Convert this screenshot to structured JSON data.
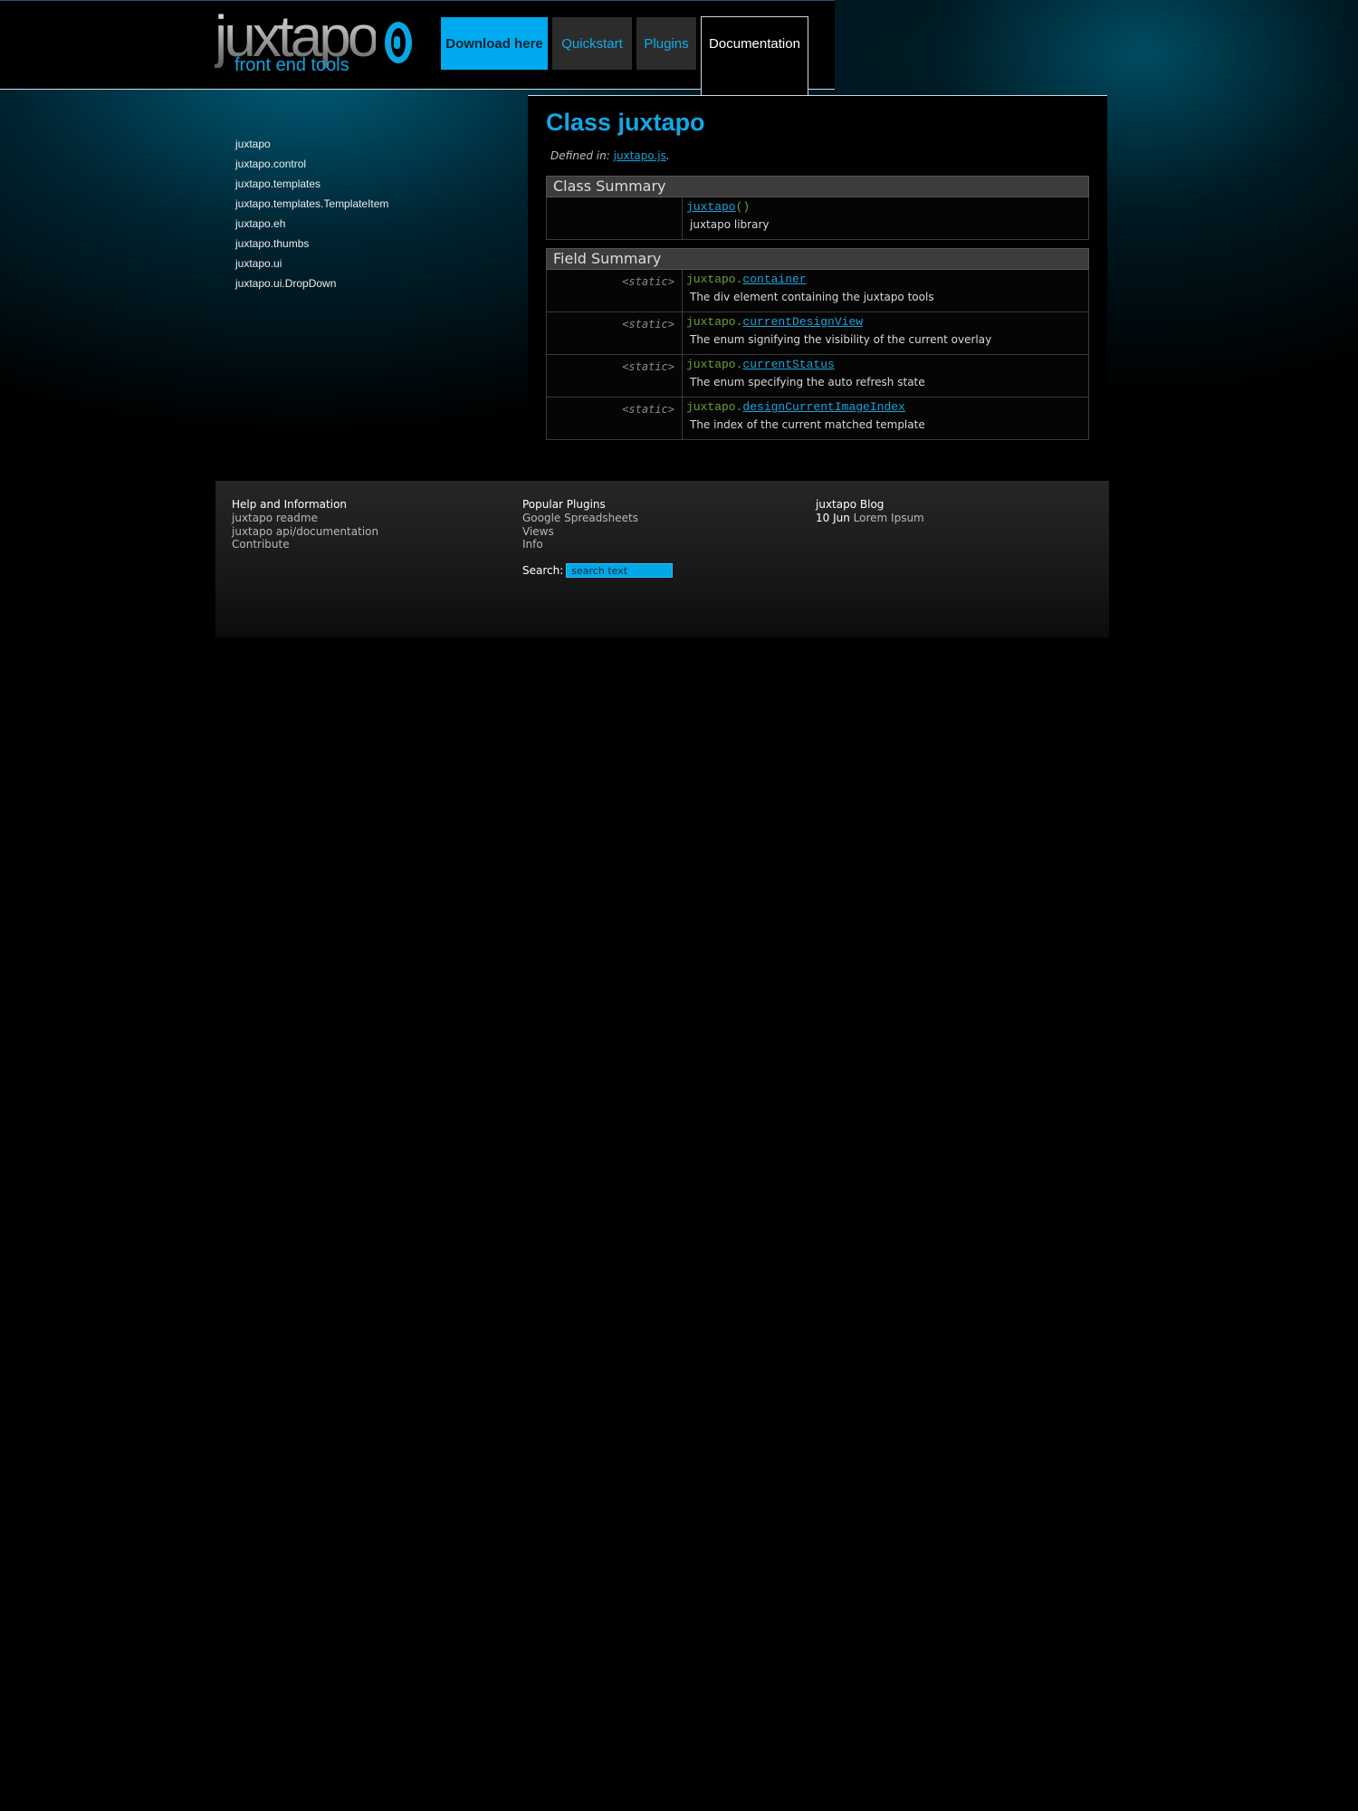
{
  "header": {
    "logo_word": "juxtapo",
    "logo_tagline": "front end tools",
    "nav": {
      "download": "Download here",
      "quickstart": "Quickstart",
      "plugins": "Plugins",
      "documentation": "Documentation"
    }
  },
  "sidebar": {
    "items": [
      "juxtapo",
      "juxtapo.control",
      "juxtapo.templates",
      "juxtapo.templates.TemplateItem",
      "juxtapo.eh",
      "juxtapo.thumbs",
      "juxtapo.ui",
      "juxtapo.ui.DropDown"
    ]
  },
  "content": {
    "title": "Class juxtapo",
    "defined_label": "Defined in:",
    "defined_file": "juxtapo.js",
    "defined_suffix": ".",
    "class_summary": {
      "heading": "Class Summary",
      "constructor_name": "juxtapo",
      "constructor_parens": "()",
      "description": "juxtapo library"
    },
    "field_summary": {
      "heading": "Field Summary",
      "rows": [
        {
          "modifier": "<static>",
          "prefix": "juxtapo.",
          "name": "container",
          "description": "The div element containing the juxtapo tools"
        },
        {
          "modifier": "<static>",
          "prefix": "juxtapo.",
          "name": "currentDesignView",
          "description": "The enum signifying the visibility of the current overlay"
        },
        {
          "modifier": "<static>",
          "prefix": "juxtapo.",
          "name": "currentStatus",
          "description": "The enum specifying the auto refresh state"
        },
        {
          "modifier": "<static>",
          "prefix": "juxtapo.",
          "name": "designCurrentImageIndex",
          "description": "The index of the current matched template"
        }
      ]
    }
  },
  "footer": {
    "help": {
      "heading": "Help and Information",
      "links": [
        "juxtapo readme",
        "juxtapo api/documentation",
        "Contribute"
      ]
    },
    "plugins": {
      "heading": "Popular Plugins",
      "links": [
        "Google Spreadsheets",
        "Views",
        "Info"
      ]
    },
    "blog": {
      "heading": "juxtapo Blog",
      "date": "10 Jun",
      "title": "Lorem Ipsum"
    },
    "search": {
      "label": "Search:",
      "placeholder": "search text"
    }
  }
}
